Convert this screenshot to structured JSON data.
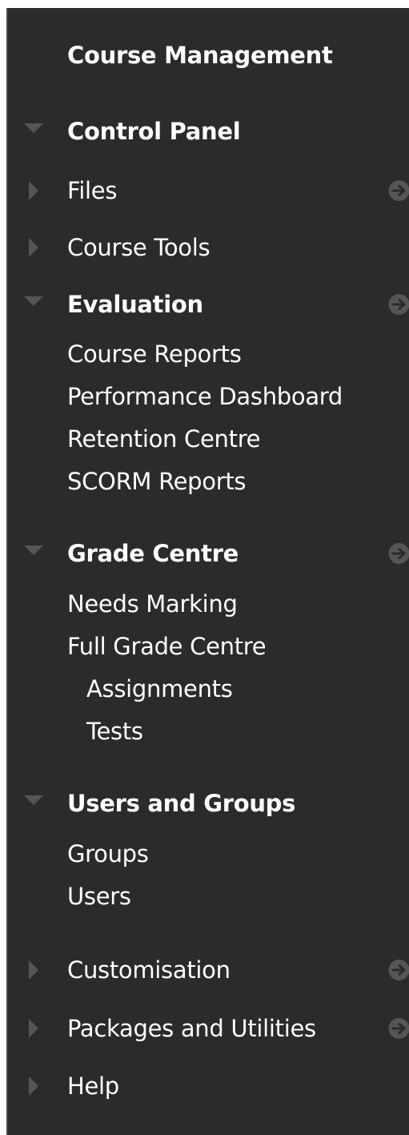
{
  "title": "Course Management",
  "control_panel": "Control Panel",
  "items": {
    "files": "Files",
    "course_tools": "Course Tools",
    "evaluation": "Evaluation",
    "course_reports": "Course Reports",
    "performance_dashboard": "Performance Dashboard",
    "retention_centre": "Retention Centre",
    "scorm_reports": "SCORM Reports",
    "grade_centre": "Grade Centre",
    "needs_marking": "Needs Marking",
    "full_grade_centre": "Full Grade Centre",
    "assignments": "Assignments",
    "tests": "Tests",
    "users_and_groups": "Users and Groups",
    "groups": "Groups",
    "users": "Users",
    "customisation": "Customisation",
    "packages_and_utilities": "Packages and Utilities",
    "help": "Help"
  },
  "icons": {
    "expanded": "triangle-down-icon",
    "collapsed": "triangle-right-icon",
    "go": "arrow-right-circle-icon"
  },
  "colors": {
    "panel_background": "#2b2b2b",
    "text": "#ffffff",
    "icon": "#555555"
  }
}
